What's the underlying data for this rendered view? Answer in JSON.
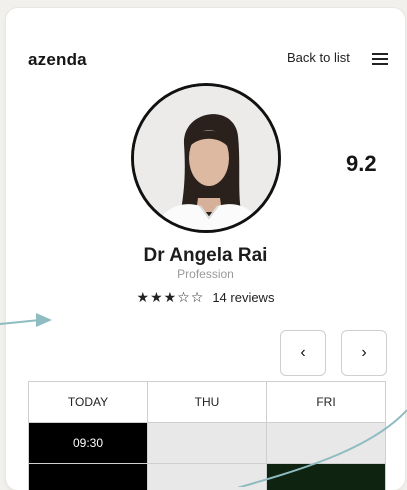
{
  "header": {
    "logo": "azenda",
    "back_label": "Back to list",
    "menu_icon": "hamburger-menu-icon"
  },
  "profile": {
    "score": "9.2",
    "name": "Dr Angela Rai",
    "profession": "Profession",
    "stars_text": "★★★☆☆",
    "rating_value": 3,
    "rating_max": 5,
    "reviews_label": "14 reviews"
  },
  "calendar": {
    "prev_label": "‹",
    "next_label": "›",
    "columns": [
      "TODAY",
      "THU",
      "FRI"
    ],
    "rows": [
      [
        "09:30",
        "",
        ""
      ],
      [
        "",
        "",
        ""
      ]
    ]
  },
  "colors": {
    "accent_teal": "#8fbcc1",
    "slot_black": "#000000",
    "slot_grey": "#e8e8e8",
    "slot_green": "#0f2410"
  }
}
